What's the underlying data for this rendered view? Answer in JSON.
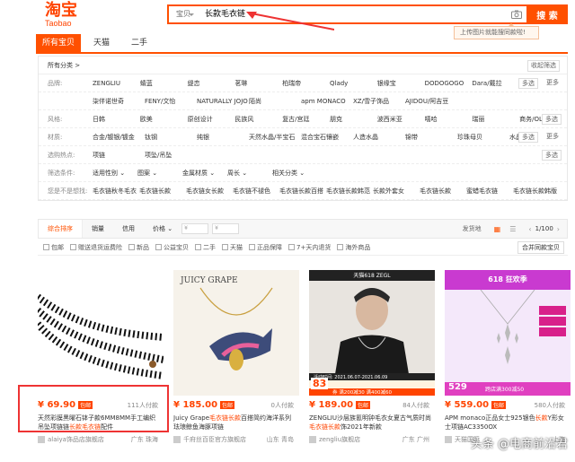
{
  "logo": {
    "cn": "淘宝",
    "en": "Taobao"
  },
  "search": {
    "category": "宝贝",
    "query": "长款毛衣链",
    "button": "搜 索",
    "tip": "上传图片就能搜同款啦!"
  },
  "tabs": [
    "所有宝贝",
    "天猫",
    "二手"
  ],
  "filters": {
    "all_categories": "所有分类 >",
    "fold": "收起筛选",
    "rows": [
      {
        "label": "品牌:",
        "values": [
          "ZENGLIU",
          "蜻蓝",
          "缇恋",
          "茗琳",
          "柏瑞帝",
          "Qlady",
          "银缘宝",
          "DODOGOGO",
          "Dara/戴拉",
          "妮妮"
        ],
        "ctl": [
          "多选",
          "更多"
        ]
      },
      {
        "label": "",
        "values": [
          "柒伴诺世奇",
          "FENY/文怡",
          "NATURALLY JOJO",
          "陌尚",
          "apm MONACO",
          "XZ/雪子饰品",
          "AJIDOU/阿吉豆"
        ],
        "ctl": []
      },
      {
        "label": "风格:",
        "values": [
          "日韩",
          "欧美",
          "原创设计",
          "民族风",
          "复古/宫廷",
          "朋克",
          "波西米亚",
          "嘻哈",
          "瑞丽",
          "商务/OL"
        ],
        "ctl": [
          "多选"
        ]
      },
      {
        "label": "材质:",
        "values": [
          "合金/镀银/镀金",
          "钛钢",
          "纯银",
          "天然水晶/半宝石",
          "混合宝石镶嵌",
          "人造水晶",
          "锦带",
          "珍珠母贝",
          "水晶"
        ],
        "ctl": [
          "多选",
          "更多"
        ]
      },
      {
        "label": "选购热点:",
        "values": [
          "项链",
          "项坠/吊坠"
        ],
        "ctl": [
          "多选"
        ]
      },
      {
        "label": "筛选条件:",
        "values": [
          "适用性别 ⌄",
          "图案 ⌄",
          "金属材质 ⌄",
          "周长 ⌄",
          "相关分类 ⌄"
        ],
        "ctl": []
      },
      {
        "label": "您是不是想找:",
        "values": [
          "毛衣链秋冬毛衣",
          "毛衣链长款",
          "毛衣链女长款",
          "毛衣链不褪色",
          "毛衣链长款百搭",
          "毛衣链长款韩范",
          "长款外套女",
          "毛衣链长款",
          "蜜蜡毛衣链",
          "毛衣链长款韩版"
        ],
        "ctl": []
      }
    ]
  },
  "sort": {
    "items": [
      "综合排序",
      "销量",
      "信用",
      "价格 ⌄"
    ],
    "price_from": "¥",
    "price_to": "¥",
    "ship": "发货地",
    "page": "1/100"
  },
  "options": [
    "包邮",
    "赠送退货运费险",
    "新品",
    "公益宝贝",
    "二手",
    "天猫",
    "正品保障",
    "7+天内退货",
    "海外商品"
  ],
  "options_right": "合并同款宝贝",
  "products": [
    {
      "price": "¥ 69.90",
      "tag": "包邮",
      "sold": "111人付款",
      "title_pre": "天然彩膜黑曜石钵子款6MM8MM手工编织吊坠项链链",
      "title_hl": "长款毛衣链",
      "title_post": "配件",
      "shop": "alaiya饰品店旗舰店",
      "loc": "广东 珠海"
    },
    {
      "price": "¥ 185.00",
      "tag": "包邮",
      "sold": "0人付款",
      "title_pre": "Juicy Grape",
      "title_hl": "毛衣链长款",
      "title_post": "百搭简约海洋系列珐琅鲸鱼海豚项链",
      "shop": "千府丝百臣官方旗舰店",
      "loc": "山东 青岛"
    },
    {
      "price": "¥ 189.00",
      "tag": "包邮",
      "sold": "84人付款",
      "title_pre": "ZENGLIU沙层族氰明钟毛衣女夏古气质时尚",
      "title_hl": "毛衣链长款",
      "title_post": "饰2021年新款",
      "shop": "zengliu旗舰店",
      "loc": "广东 广州"
    },
    {
      "price": "¥ 559.00",
      "tag": "包邮",
      "sold": "580人付款",
      "title_pre": "APM monaco正品女士925银色",
      "title_hl": "长款",
      "title_post": "Y形女士项链AC3350OX",
      "shop": "天猫国际",
      "loc": "上海"
    }
  ],
  "card_banners": {
    "c3_top": "天猫618 ZEGL",
    "c3_date": "活动时间: 2021.06.07-2021.06.09",
    "c3_price": "83",
    "c3_coupon": "券 满200减30 满400减60",
    "c4_top": "618 狂欢季",
    "c4_price": "529",
    "c4_coupon": "跨店满300减50"
  },
  "watermark": "头条 @电商前沿君",
  "colors": {
    "accent": "#ff5000",
    "highlight": "#e33333"
  }
}
